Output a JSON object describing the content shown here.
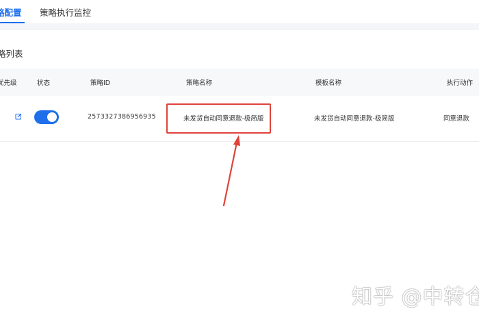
{
  "tabs": [
    {
      "label": "略配置",
      "active": true
    },
    {
      "label": "策略执行监控",
      "active": false
    }
  ],
  "section_title": "略列表",
  "table": {
    "columns": [
      "优先级",
      "状态",
      "策略ID",
      "策略名称",
      "模板名称",
      "执行动作"
    ],
    "rows": [
      {
        "status_on": true,
        "id": "2573327386956935",
        "name": "未发货自动同意退款-极简版",
        "template": "未发货自动同意退款-极简版",
        "action": "同意退款"
      }
    ]
  },
  "colors": {
    "accent": "#1f6feb",
    "highlight": "#e0423a"
  },
  "icons": {
    "edit": "edit-icon",
    "arrow": "arrow-up-annotation"
  },
  "watermark": "知乎 @中转仓"
}
